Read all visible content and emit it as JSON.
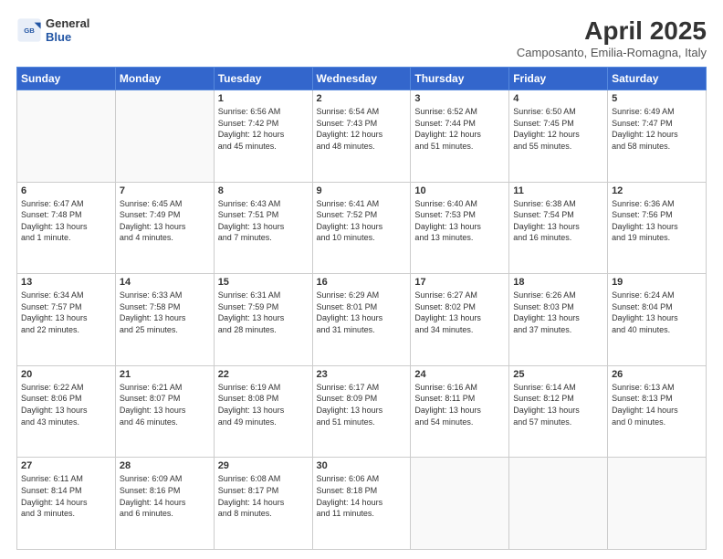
{
  "header": {
    "logo_general": "General",
    "logo_blue": "Blue",
    "month_title": "April 2025",
    "subtitle": "Camposanto, Emilia-Romagna, Italy"
  },
  "columns": [
    "Sunday",
    "Monday",
    "Tuesday",
    "Wednesday",
    "Thursday",
    "Friday",
    "Saturday"
  ],
  "weeks": [
    [
      {
        "day": "",
        "info": ""
      },
      {
        "day": "",
        "info": ""
      },
      {
        "day": "1",
        "info": "Sunrise: 6:56 AM\nSunset: 7:42 PM\nDaylight: 12 hours\nand 45 minutes."
      },
      {
        "day": "2",
        "info": "Sunrise: 6:54 AM\nSunset: 7:43 PM\nDaylight: 12 hours\nand 48 minutes."
      },
      {
        "day": "3",
        "info": "Sunrise: 6:52 AM\nSunset: 7:44 PM\nDaylight: 12 hours\nand 51 minutes."
      },
      {
        "day": "4",
        "info": "Sunrise: 6:50 AM\nSunset: 7:45 PM\nDaylight: 12 hours\nand 55 minutes."
      },
      {
        "day": "5",
        "info": "Sunrise: 6:49 AM\nSunset: 7:47 PM\nDaylight: 12 hours\nand 58 minutes."
      }
    ],
    [
      {
        "day": "6",
        "info": "Sunrise: 6:47 AM\nSunset: 7:48 PM\nDaylight: 13 hours\nand 1 minute."
      },
      {
        "day": "7",
        "info": "Sunrise: 6:45 AM\nSunset: 7:49 PM\nDaylight: 13 hours\nand 4 minutes."
      },
      {
        "day": "8",
        "info": "Sunrise: 6:43 AM\nSunset: 7:51 PM\nDaylight: 13 hours\nand 7 minutes."
      },
      {
        "day": "9",
        "info": "Sunrise: 6:41 AM\nSunset: 7:52 PM\nDaylight: 13 hours\nand 10 minutes."
      },
      {
        "day": "10",
        "info": "Sunrise: 6:40 AM\nSunset: 7:53 PM\nDaylight: 13 hours\nand 13 minutes."
      },
      {
        "day": "11",
        "info": "Sunrise: 6:38 AM\nSunset: 7:54 PM\nDaylight: 13 hours\nand 16 minutes."
      },
      {
        "day": "12",
        "info": "Sunrise: 6:36 AM\nSunset: 7:56 PM\nDaylight: 13 hours\nand 19 minutes."
      }
    ],
    [
      {
        "day": "13",
        "info": "Sunrise: 6:34 AM\nSunset: 7:57 PM\nDaylight: 13 hours\nand 22 minutes."
      },
      {
        "day": "14",
        "info": "Sunrise: 6:33 AM\nSunset: 7:58 PM\nDaylight: 13 hours\nand 25 minutes."
      },
      {
        "day": "15",
        "info": "Sunrise: 6:31 AM\nSunset: 7:59 PM\nDaylight: 13 hours\nand 28 minutes."
      },
      {
        "day": "16",
        "info": "Sunrise: 6:29 AM\nSunset: 8:01 PM\nDaylight: 13 hours\nand 31 minutes."
      },
      {
        "day": "17",
        "info": "Sunrise: 6:27 AM\nSunset: 8:02 PM\nDaylight: 13 hours\nand 34 minutes."
      },
      {
        "day": "18",
        "info": "Sunrise: 6:26 AM\nSunset: 8:03 PM\nDaylight: 13 hours\nand 37 minutes."
      },
      {
        "day": "19",
        "info": "Sunrise: 6:24 AM\nSunset: 8:04 PM\nDaylight: 13 hours\nand 40 minutes."
      }
    ],
    [
      {
        "day": "20",
        "info": "Sunrise: 6:22 AM\nSunset: 8:06 PM\nDaylight: 13 hours\nand 43 minutes."
      },
      {
        "day": "21",
        "info": "Sunrise: 6:21 AM\nSunset: 8:07 PM\nDaylight: 13 hours\nand 46 minutes."
      },
      {
        "day": "22",
        "info": "Sunrise: 6:19 AM\nSunset: 8:08 PM\nDaylight: 13 hours\nand 49 minutes."
      },
      {
        "day": "23",
        "info": "Sunrise: 6:17 AM\nSunset: 8:09 PM\nDaylight: 13 hours\nand 51 minutes."
      },
      {
        "day": "24",
        "info": "Sunrise: 6:16 AM\nSunset: 8:11 PM\nDaylight: 13 hours\nand 54 minutes."
      },
      {
        "day": "25",
        "info": "Sunrise: 6:14 AM\nSunset: 8:12 PM\nDaylight: 13 hours\nand 57 minutes."
      },
      {
        "day": "26",
        "info": "Sunrise: 6:13 AM\nSunset: 8:13 PM\nDaylight: 14 hours\nand 0 minutes."
      }
    ],
    [
      {
        "day": "27",
        "info": "Sunrise: 6:11 AM\nSunset: 8:14 PM\nDaylight: 14 hours\nand 3 minutes."
      },
      {
        "day": "28",
        "info": "Sunrise: 6:09 AM\nSunset: 8:16 PM\nDaylight: 14 hours\nand 6 minutes."
      },
      {
        "day": "29",
        "info": "Sunrise: 6:08 AM\nSunset: 8:17 PM\nDaylight: 14 hours\nand 8 minutes."
      },
      {
        "day": "30",
        "info": "Sunrise: 6:06 AM\nSunset: 8:18 PM\nDaylight: 14 hours\nand 11 minutes."
      },
      {
        "day": "",
        "info": ""
      },
      {
        "day": "",
        "info": ""
      },
      {
        "day": "",
        "info": ""
      }
    ]
  ]
}
